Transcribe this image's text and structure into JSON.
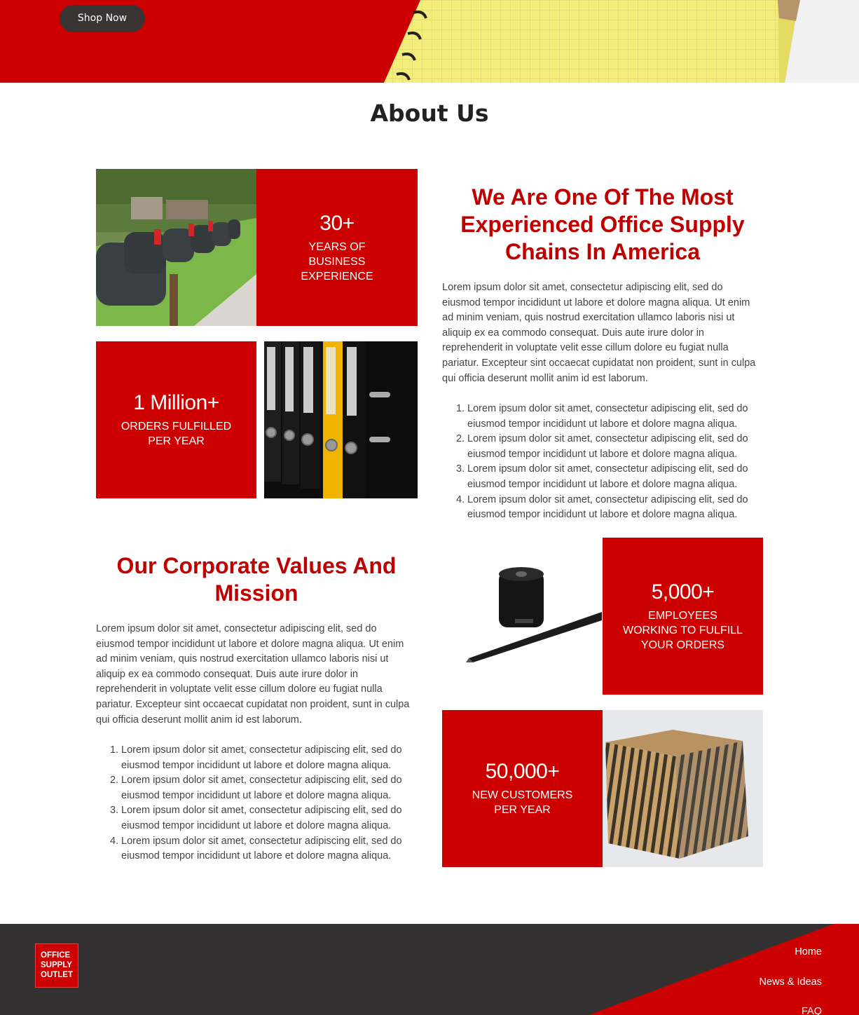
{
  "hero": {
    "shop_label": "Shop Now"
  },
  "about": {
    "title": "About Us"
  },
  "stats": [
    {
      "value": "30+",
      "label": "YEARS OF BUSINESS EXPERIENCE"
    },
    {
      "value": "1 Million+",
      "label": "ORDERS FULFILLED PER YEAR"
    },
    {
      "value": "5,000+",
      "label": "EMPLOYEES WORKING TO FULFILL YOUR ORDERS"
    },
    {
      "value": "50,000+",
      "label": "NEW CUSTOMERS PER YEAR"
    }
  ],
  "section_experience": {
    "heading": "We Are One Of The Most Experienced Office Supply Chains In America",
    "paragraph": "Lorem ipsum dolor sit amet, consectetur adipiscing elit, sed do eiusmod tempor incididunt ut labore et dolore magna aliqua. Ut enim ad minim veniam, quis nostrud exercitation ullamco laboris nisi ut aliquip ex ea commodo consequat. Duis aute irure dolor in reprehenderit in voluptate velit esse cillum dolore eu fugiat nulla pariatur. Excepteur sint occaecat cupidatat non proident, sunt in culpa qui officia deserunt mollit anim id est laborum.",
    "items": [
      "Lorem ipsum dolor sit amet, consectetur adipiscing elit, sed do eiusmod tempor incididunt ut labore et dolore magna aliqua.",
      "Lorem ipsum dolor sit amet, consectetur adipiscing elit, sed do eiusmod tempor incididunt ut labore et dolore magna aliqua.",
      "Lorem ipsum dolor sit amet, consectetur adipiscing elit, sed do eiusmod tempor incididunt ut labore et dolore magna aliqua.",
      "Lorem ipsum dolor sit amet, consectetur adipiscing elit, sed do eiusmod tempor incididunt ut labore et dolore magna aliqua."
    ]
  },
  "section_values": {
    "heading": "Our Corporate Values And Mission",
    "paragraph": "Lorem ipsum dolor sit amet, consectetur adipiscing elit, sed do eiusmod tempor incididunt ut labore et dolore magna aliqua. Ut enim ad minim veniam, quis nostrud exercitation ullamco laboris nisi ut aliquip ex ea commodo consequat. Duis aute irure dolor in reprehenderit in voluptate velit esse cillum dolore eu fugiat nulla pariatur. Excepteur sint occaecat cupidatat non proident, sunt in culpa qui officia deserunt mollit anim id est laborum.",
    "items": [
      "Lorem ipsum dolor sit amet, consectetur adipiscing elit, sed do eiusmod tempor incididunt ut labore et dolore magna aliqua.",
      "Lorem ipsum dolor sit amet, consectetur adipiscing elit, sed do eiusmod tempor incididunt ut labore et dolore magna aliqua.",
      "Lorem ipsum dolor sit amet, consectetur adipiscing elit, sed do eiusmod tempor incididunt ut labore et dolore magna aliqua.",
      "Lorem ipsum dolor sit amet, consectetur adipiscing elit, sed do eiusmod tempor incididunt ut labore et dolore magna aliqua."
    ]
  },
  "footer": {
    "logo_lines": [
      "OFFICE",
      "SUPPLY",
      "OUTLET"
    ],
    "links": [
      "Home",
      "News & Ideas",
      "FAQ"
    ]
  },
  "colors": {
    "brand_red": "#cc0000",
    "heading_red": "#c00000",
    "footer_dark": "#343132",
    "button_dark": "#3a3435"
  },
  "icons": [
    "notebook-image",
    "mailbox-image",
    "binders-image",
    "pen-image",
    "box-image"
  ]
}
